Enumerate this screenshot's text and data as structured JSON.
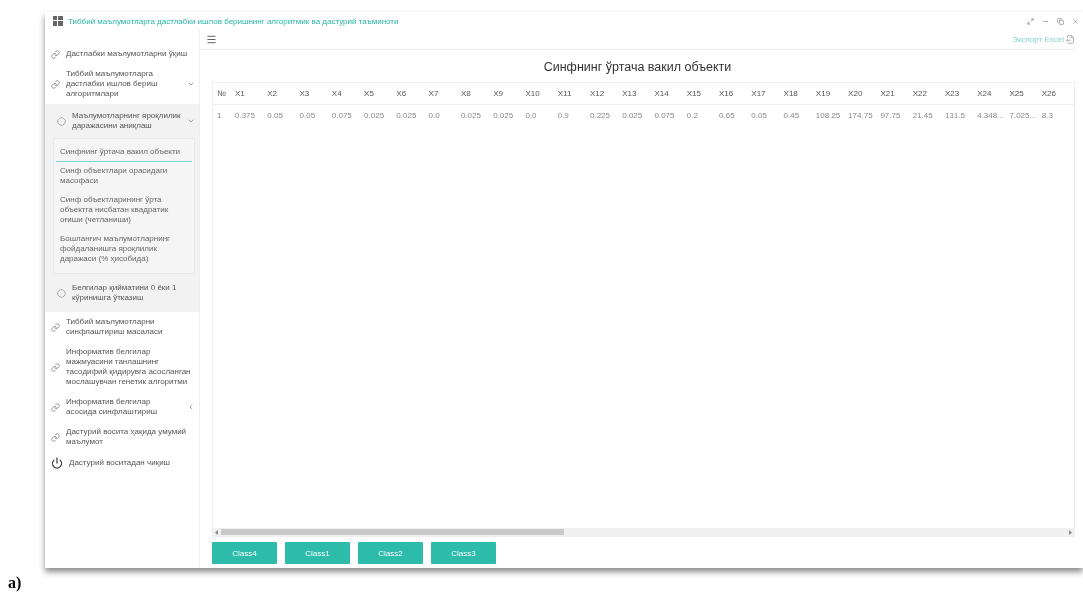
{
  "window": {
    "title": "Тиббий маълумотларга дастлабки ишлов беришнинг алгоритмик ва дастурий таъминоти"
  },
  "sidebar": {
    "items": [
      {
        "label": "Дастлабки маълумотларни ўқиш",
        "kind": "link"
      },
      {
        "label": "Тиббий маълумотларга дастлабки ишлов бериш алгоритмлари",
        "kind": "link",
        "expanded": true,
        "children": [
          {
            "label": "Маълумотларнинг яроқлилик даражасини аниқлаш",
            "kind": "ring",
            "expanded": true,
            "children": [
              {
                "label": "Синфнинг ўртача вакил объекти",
                "selected": true
              },
              {
                "label": "Синф объектлари орасидаги масофаси",
                "selected": false
              },
              {
                "label": "Синф объектларининг ўрта объектга нисбатан квадратик оғиши (четланиши)",
                "selected": false
              },
              {
                "label": "Бошланғич маълумотларнинг фойдаланишга яроқлилик даражаси (% ҳисобида)",
                "selected": false
              }
            ]
          },
          {
            "label": "Белгилар қийматини 0 ёки 1 кўринишга ўтказиш",
            "kind": "ring"
          }
        ]
      },
      {
        "label": "Тиббий маълумотларни синфлаштириш масаласи",
        "kind": "link"
      },
      {
        "label": "Информатив белгилар мажмуасини танлашнинг тасодифий қидирувга асосланган мослашувчан генетик алгоритми",
        "kind": "link"
      },
      {
        "label": "Информатив белгилар асосида синфлаштириш",
        "kind": "link",
        "expanded": false
      },
      {
        "label": "Дастурий восита ҳақида умумий маълумот",
        "kind": "link"
      },
      {
        "label": "Дастурий воситадан чиқиш",
        "kind": "power"
      }
    ]
  },
  "toolbar": {
    "export_label": "Экспорт Excel"
  },
  "main": {
    "title": "Синфнинг ўртача вакил объекти",
    "table": {
      "columns": [
        "№",
        "X1",
        "X2",
        "X3",
        "X4",
        "X5",
        "X6",
        "X7",
        "X8",
        "X9",
        "X10",
        "X11",
        "X12",
        "X13",
        "X14",
        "X15",
        "X16",
        "X17",
        "X18",
        "X19",
        "X20",
        "X21",
        "X22",
        "X23",
        "X24",
        "X25",
        "X26"
      ],
      "rows": [
        [
          "1",
          "0.375",
          "0.05",
          "0.05",
          "0.075",
          "0.025",
          "0.025",
          "0.0",
          "0.025",
          "0.025",
          "0.0",
          "0.9",
          "0.225",
          "0.025",
          "0.075",
          "0.2",
          "0.65",
          "0.05",
          "0.45",
          "108.25",
          "174.75",
          "97.75",
          "21.45",
          "131.5",
          "4.348...",
          "7.025...",
          "8.3"
        ]
      ]
    }
  },
  "buttons": [
    "Class4",
    "Class1",
    "Class2",
    "Class3"
  ],
  "caption": "a)"
}
